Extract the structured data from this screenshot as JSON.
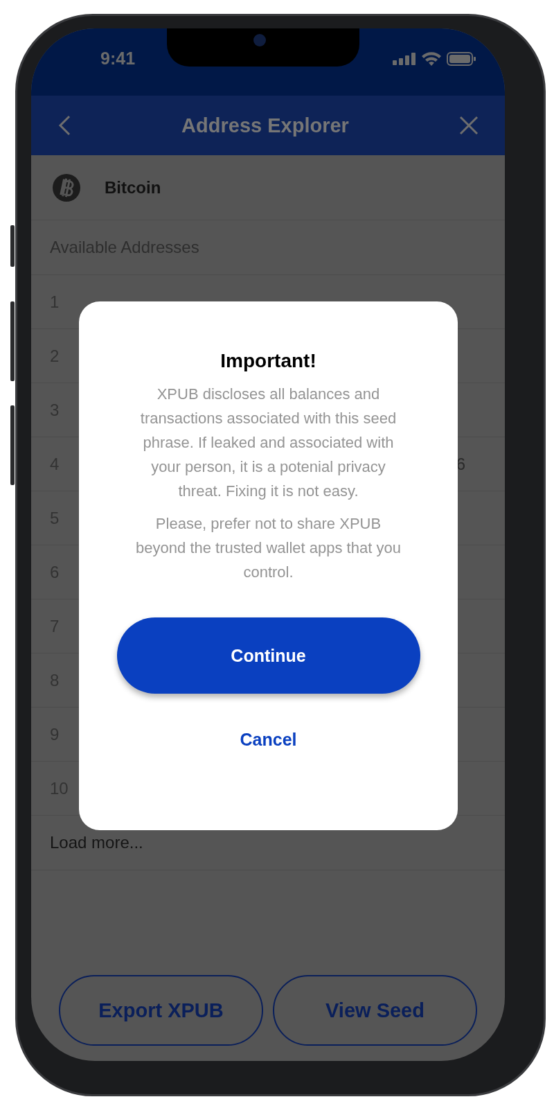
{
  "status_bar": {
    "time": "9:41"
  },
  "header": {
    "title": "Address Explorer"
  },
  "coin": {
    "name": "Bitcoin"
  },
  "list_header": "Available Addresses",
  "rows": [
    {
      "number": "1"
    },
    {
      "number": "2"
    },
    {
      "number": "3"
    },
    {
      "number": "4",
      "address": "6",
      "kind": "tail"
    },
    {
      "number": "5"
    },
    {
      "number": "6"
    },
    {
      "number": "7"
    },
    {
      "number": "8"
    },
    {
      "number": "9"
    },
    {
      "number": "10"
    }
  ],
  "load_more": "Load more...",
  "modal": {
    "title": "Important!",
    "paragraphs": [
      "XPUB discloses all balances and transactions associated with this seed phrase. If leaked and associated with your person, it is a potenial privacy threat. Fixing it is not easy.",
      "Please, prefer not to share XPUB beyond the trusted wallet apps that you control."
    ],
    "primary": "Continue",
    "secondary": "Cancel"
  },
  "buttons": [
    "Export XPUB",
    "View Seed"
  ]
}
